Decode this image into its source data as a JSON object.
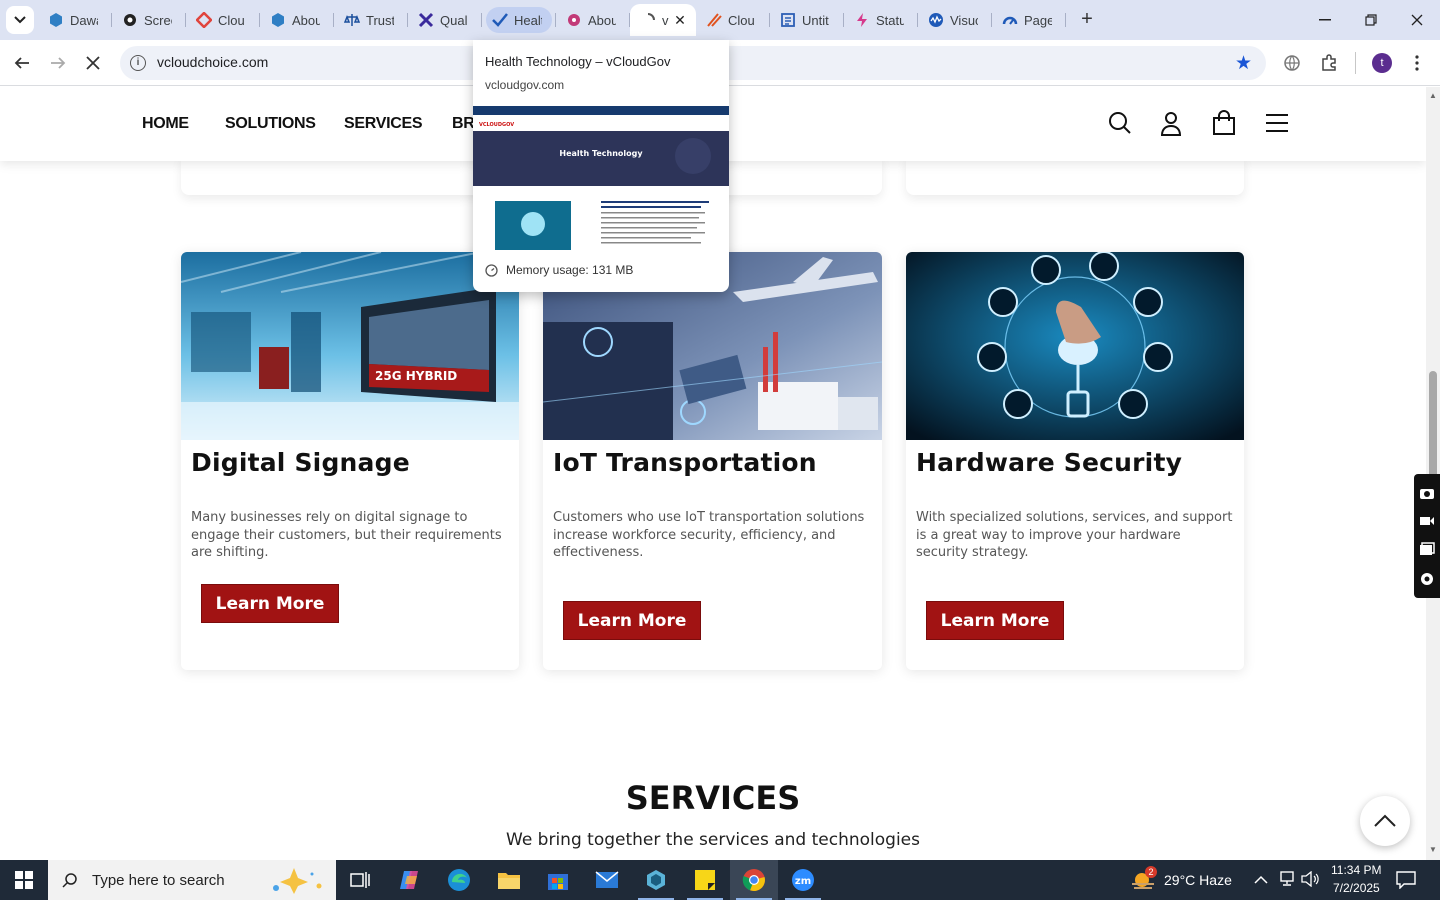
{
  "browser": {
    "tabs": [
      {
        "title": "Dawa",
        "icon": "hexagon-blue"
      },
      {
        "title": "Scree",
        "icon": "gear-dark"
      },
      {
        "title": "Clou",
        "icon": "diamond-red"
      },
      {
        "title": "Abou",
        "icon": "hexagon-blue"
      },
      {
        "title": "Trust",
        "icon": "scale"
      },
      {
        "title": "Qual",
        "icon": "x-purple"
      },
      {
        "title": "Healt",
        "icon": "check-blue"
      },
      {
        "title": "Abou",
        "icon": "circle-pink"
      },
      {
        "title": "v",
        "icon": "loading"
      },
      {
        "title": "Clou",
        "icon": "slash-orange"
      },
      {
        "title": "Untit",
        "icon": "doc-blue"
      },
      {
        "title": "Statu",
        "icon": "bolt-pink"
      },
      {
        "title": "Visuc",
        "icon": "wave-blue"
      },
      {
        "title": "Page",
        "icon": "gauge-blue"
      }
    ],
    "url": "vcloudchoice.com",
    "profile_initial": "t",
    "preview": {
      "title": "Health Technology – vCloudGov",
      "domain": "vcloudgov.com",
      "memory": "Memory usage: 131 MB",
      "thumb_banner": "Health Technology",
      "thumb_logo": "VCLOUDGOV"
    }
  },
  "site": {
    "nav": [
      "HOME",
      "SOLUTIONS",
      "SERVICES",
      "BR"
    ],
    "cards": [
      {
        "title": "Digital Signage",
        "desc": "Many businesses rely on digital signage to engage their customers, but their requirements are shifting.",
        "button": "Learn More",
        "image_text": "25G HYBRID"
      },
      {
        "title": "IoT Transportation",
        "desc": "Customers who use IoT transportation solutions increase workforce security, efficiency, and effectiveness.",
        "button": "Learn More"
      },
      {
        "title": "Hardware Security",
        "desc": "With specialized solutions, services, and support is a great way to improve your hardware security strategy.",
        "button": "Learn More"
      }
    ],
    "services_title": "SERVICES",
    "services_sub": "We bring together the services and technologies"
  },
  "taskbar": {
    "search_placeholder": "Type here to search",
    "weather_badge": "2",
    "weather": "29°C  Haze",
    "time": "11:34 PM",
    "date": "7/2/2025"
  },
  "colors": {
    "accent_red": "#a11313",
    "chrome_bg": "#dde3f3",
    "taskbar": "#1f2a38"
  }
}
